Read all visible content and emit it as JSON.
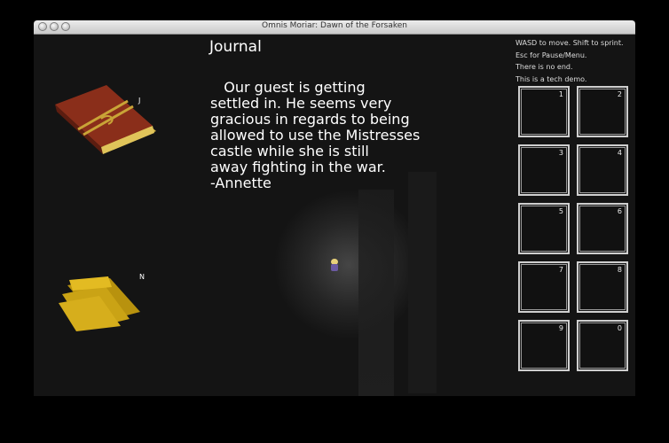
{
  "window": {
    "title": "Omnis Moriar: Dawn of the Forsaken"
  },
  "journal": {
    "heading": "Journal",
    "lines": [
      "   Our guest is getting",
      "settled in. He seems very",
      "gracious in regards to being",
      "allowed to use the Mistresses",
      "castle while she is still",
      "away fighting in the war.",
      "-Annette"
    ]
  },
  "items": {
    "journal_key": "J",
    "notes_key": "N"
  },
  "help": {
    "lines": [
      "WASD to move. Shift to sprint.",
      "Esc for Pause/Menu.",
      "There is no end.",
      "This is a tech demo."
    ]
  },
  "inventory": {
    "slots": [
      "1",
      "2",
      "3",
      "4",
      "5",
      "6",
      "7",
      "8",
      "9",
      "0"
    ]
  }
}
